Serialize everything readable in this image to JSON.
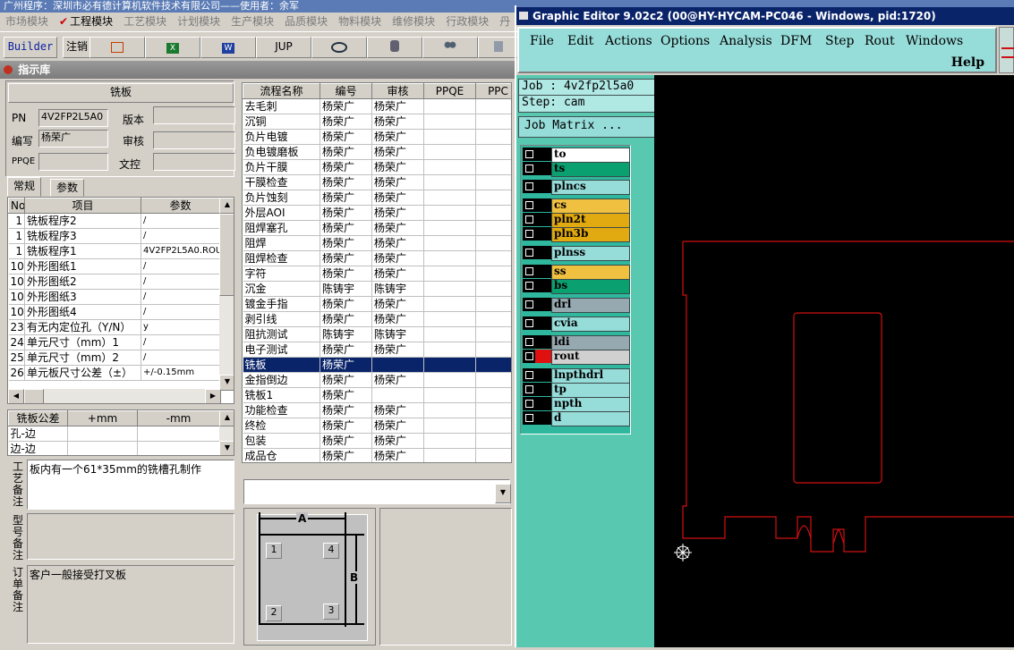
{
  "top_title": "广州程序：深圳市必有德计算机软件技术有限公司——使用者：余军",
  "modules": [
    {
      "label": "市场模块",
      "active": false
    },
    {
      "label": "工程模块",
      "active": true
    },
    {
      "label": "工艺模块",
      "active": false
    },
    {
      "label": "计划模块",
      "active": false
    },
    {
      "label": "生产模块",
      "active": false
    },
    {
      "label": "品质模块",
      "active": false
    },
    {
      "label": "物料模块",
      "active": false
    },
    {
      "label": "维修模块",
      "active": false
    },
    {
      "label": "行政模块",
      "active": false
    },
    {
      "label": "丹",
      "active": false
    }
  ],
  "toolbar": {
    "builder": "Builder",
    "logout": "注销",
    "jup": "JUP",
    "icons": [
      "html-icon",
      "excel-icon",
      "word-icon",
      "jup",
      "eye-icon",
      "database-icon",
      "users-icon",
      "more-icon"
    ]
  },
  "window_header": "指示库",
  "form": {
    "title": "铣板",
    "pn_label": "PN",
    "pn_value": "4V2FP2L5A0",
    "version_label": "版本",
    "version_value": "",
    "author_label": "编写",
    "author_value": "杨荣广",
    "review_label": "审核",
    "review_value": "",
    "ppqe_label": "PPQE",
    "ppqe_value": "",
    "doc_label": "文控",
    "doc_value": ""
  },
  "tabs": [
    {
      "label": "常规"
    },
    {
      "label": "参数"
    }
  ],
  "param_table": {
    "headers": [
      "No",
      "项目",
      "参数"
    ],
    "rows": [
      [
        "1",
        "铣板程序2",
        "/"
      ],
      [
        "1",
        "铣板程序3",
        "/"
      ],
      [
        "1",
        "铣板程序1",
        "4V2FP2L5A0.ROU"
      ],
      [
        "10",
        "外形图纸1",
        "/"
      ],
      [
        "10",
        "外形图纸2",
        "/"
      ],
      [
        "10",
        "外形图纸3",
        "/"
      ],
      [
        "10",
        "外形图纸4",
        "/"
      ],
      [
        "23",
        "有无内定位孔（Y/N）",
        "y"
      ],
      [
        "24",
        "单元尺寸（mm）1",
        "/"
      ],
      [
        "25",
        "单元尺寸（mm）2",
        "/"
      ],
      [
        "26",
        "单元板尺寸公差（±）",
        "+/-0.15mm"
      ]
    ]
  },
  "tolerance_table": {
    "headers": [
      "铣板公差",
      "+mm",
      "-mm"
    ],
    "rows": [
      [
        "孔-边",
        "",
        ""
      ],
      [
        "边-边",
        "",
        ""
      ]
    ]
  },
  "notes": {
    "process_label": "工艺备注",
    "process_text": "板内有一个61*35mm的铣槽孔制作",
    "type_label": "型号备注",
    "type_text": "",
    "order_label": "订单备注",
    "order_text": "客户一般接受打叉板"
  },
  "process_table": {
    "headers": [
      "流程名称",
      "编号",
      "审核",
      "PPQE",
      "PPC"
    ],
    "selected_index": 17,
    "rows": [
      [
        "去毛刺",
        "杨荣广",
        "杨荣广"
      ],
      [
        "沉铜",
        "杨荣广",
        "杨荣广"
      ],
      [
        "负片电镀",
        "杨荣广",
        "杨荣广"
      ],
      [
        "负电镀磨板",
        "杨荣广",
        "杨荣广"
      ],
      [
        "负片干膜",
        "杨荣广",
        "杨荣广"
      ],
      [
        "干膜检查",
        "杨荣广",
        "杨荣广"
      ],
      [
        "负片蚀刻",
        "杨荣广",
        "杨荣广"
      ],
      [
        "外层AOI",
        "杨荣广",
        "杨荣广"
      ],
      [
        "阻焊塞孔",
        "杨荣广",
        "杨荣广"
      ],
      [
        "阻焊",
        "杨荣广",
        "杨荣广"
      ],
      [
        "阻焊检查",
        "杨荣广",
        "杨荣广"
      ],
      [
        "字符",
        "杨荣广",
        "杨荣广"
      ],
      [
        "沉金",
        "陈铸宇",
        "陈铸宇"
      ],
      [
        "镀金手指",
        "杨荣广",
        "杨荣广"
      ],
      [
        "剥引线",
        "杨荣广",
        "杨荣广"
      ],
      [
        "阻抗测试",
        "陈铸宇",
        "陈铸宇"
      ],
      [
        "电子测试",
        "杨荣广",
        "杨荣广"
      ],
      [
        "铣板",
        "杨荣广",
        ""
      ],
      [
        "金指倒边",
        "杨荣广",
        "杨荣广"
      ],
      [
        "铣板1",
        "杨荣广",
        ""
      ],
      [
        "功能检查",
        "杨荣广",
        "杨荣广"
      ],
      [
        "终检",
        "杨荣广",
        "杨荣广"
      ],
      [
        "包装",
        "杨荣广",
        "杨荣广"
      ],
      [
        "成品仓",
        "杨荣广",
        "杨荣广"
      ]
    ]
  },
  "combo_value": "",
  "diagram": {
    "a": "A",
    "b": "B",
    "corners": [
      "1",
      "4",
      "2",
      "3"
    ]
  },
  "ge": {
    "title": "Graphic Editor 9.02c2 (00@HY-HYCAM-PC046 - Windows, pid:1720)",
    "menu": [
      "File",
      "Edit",
      "Actions",
      "Options",
      "Analysis",
      "DFM",
      "Step",
      "Rout",
      "Windows"
    ],
    "help": "Help",
    "job": "Job : 4v2fp2l5a0",
    "step": "Step: cam",
    "job_matrix": "Job Matrix ...",
    "layers": [
      {
        "name": "to",
        "color": "#ffffff"
      },
      {
        "name": "ts",
        "color": "#0aa070"
      },
      {
        "name": "plncs",
        "color": "#96dcd9"
      },
      {
        "name": "cs",
        "color": "#f0c040"
      },
      {
        "name": "pln2t",
        "color": "#e0aa10"
      },
      {
        "name": "pln3b",
        "color": "#e0aa10"
      },
      {
        "name": "plnss",
        "color": "#96dcd9"
      },
      {
        "name": "ss",
        "color": "#f0c040"
      },
      {
        "name": "bs",
        "color": "#0aa070"
      },
      {
        "name": "drl",
        "color": "#96a8b0"
      },
      {
        "name": "cvia",
        "color": "#96dcd9"
      },
      {
        "name": "ldi",
        "color": "#96a8b0"
      },
      {
        "name": "rout",
        "color": "#d0d0d0"
      },
      {
        "name": "lnpthdrl",
        "color": "#96dcd9"
      },
      {
        "name": "tp",
        "color": "#96dcd9"
      },
      {
        "name": "npth",
        "color": "#96dcd9"
      },
      {
        "name": "d",
        "color": "#96dcd9"
      }
    ],
    "active_layer": "rout",
    "outline_color": "#d01010"
  }
}
